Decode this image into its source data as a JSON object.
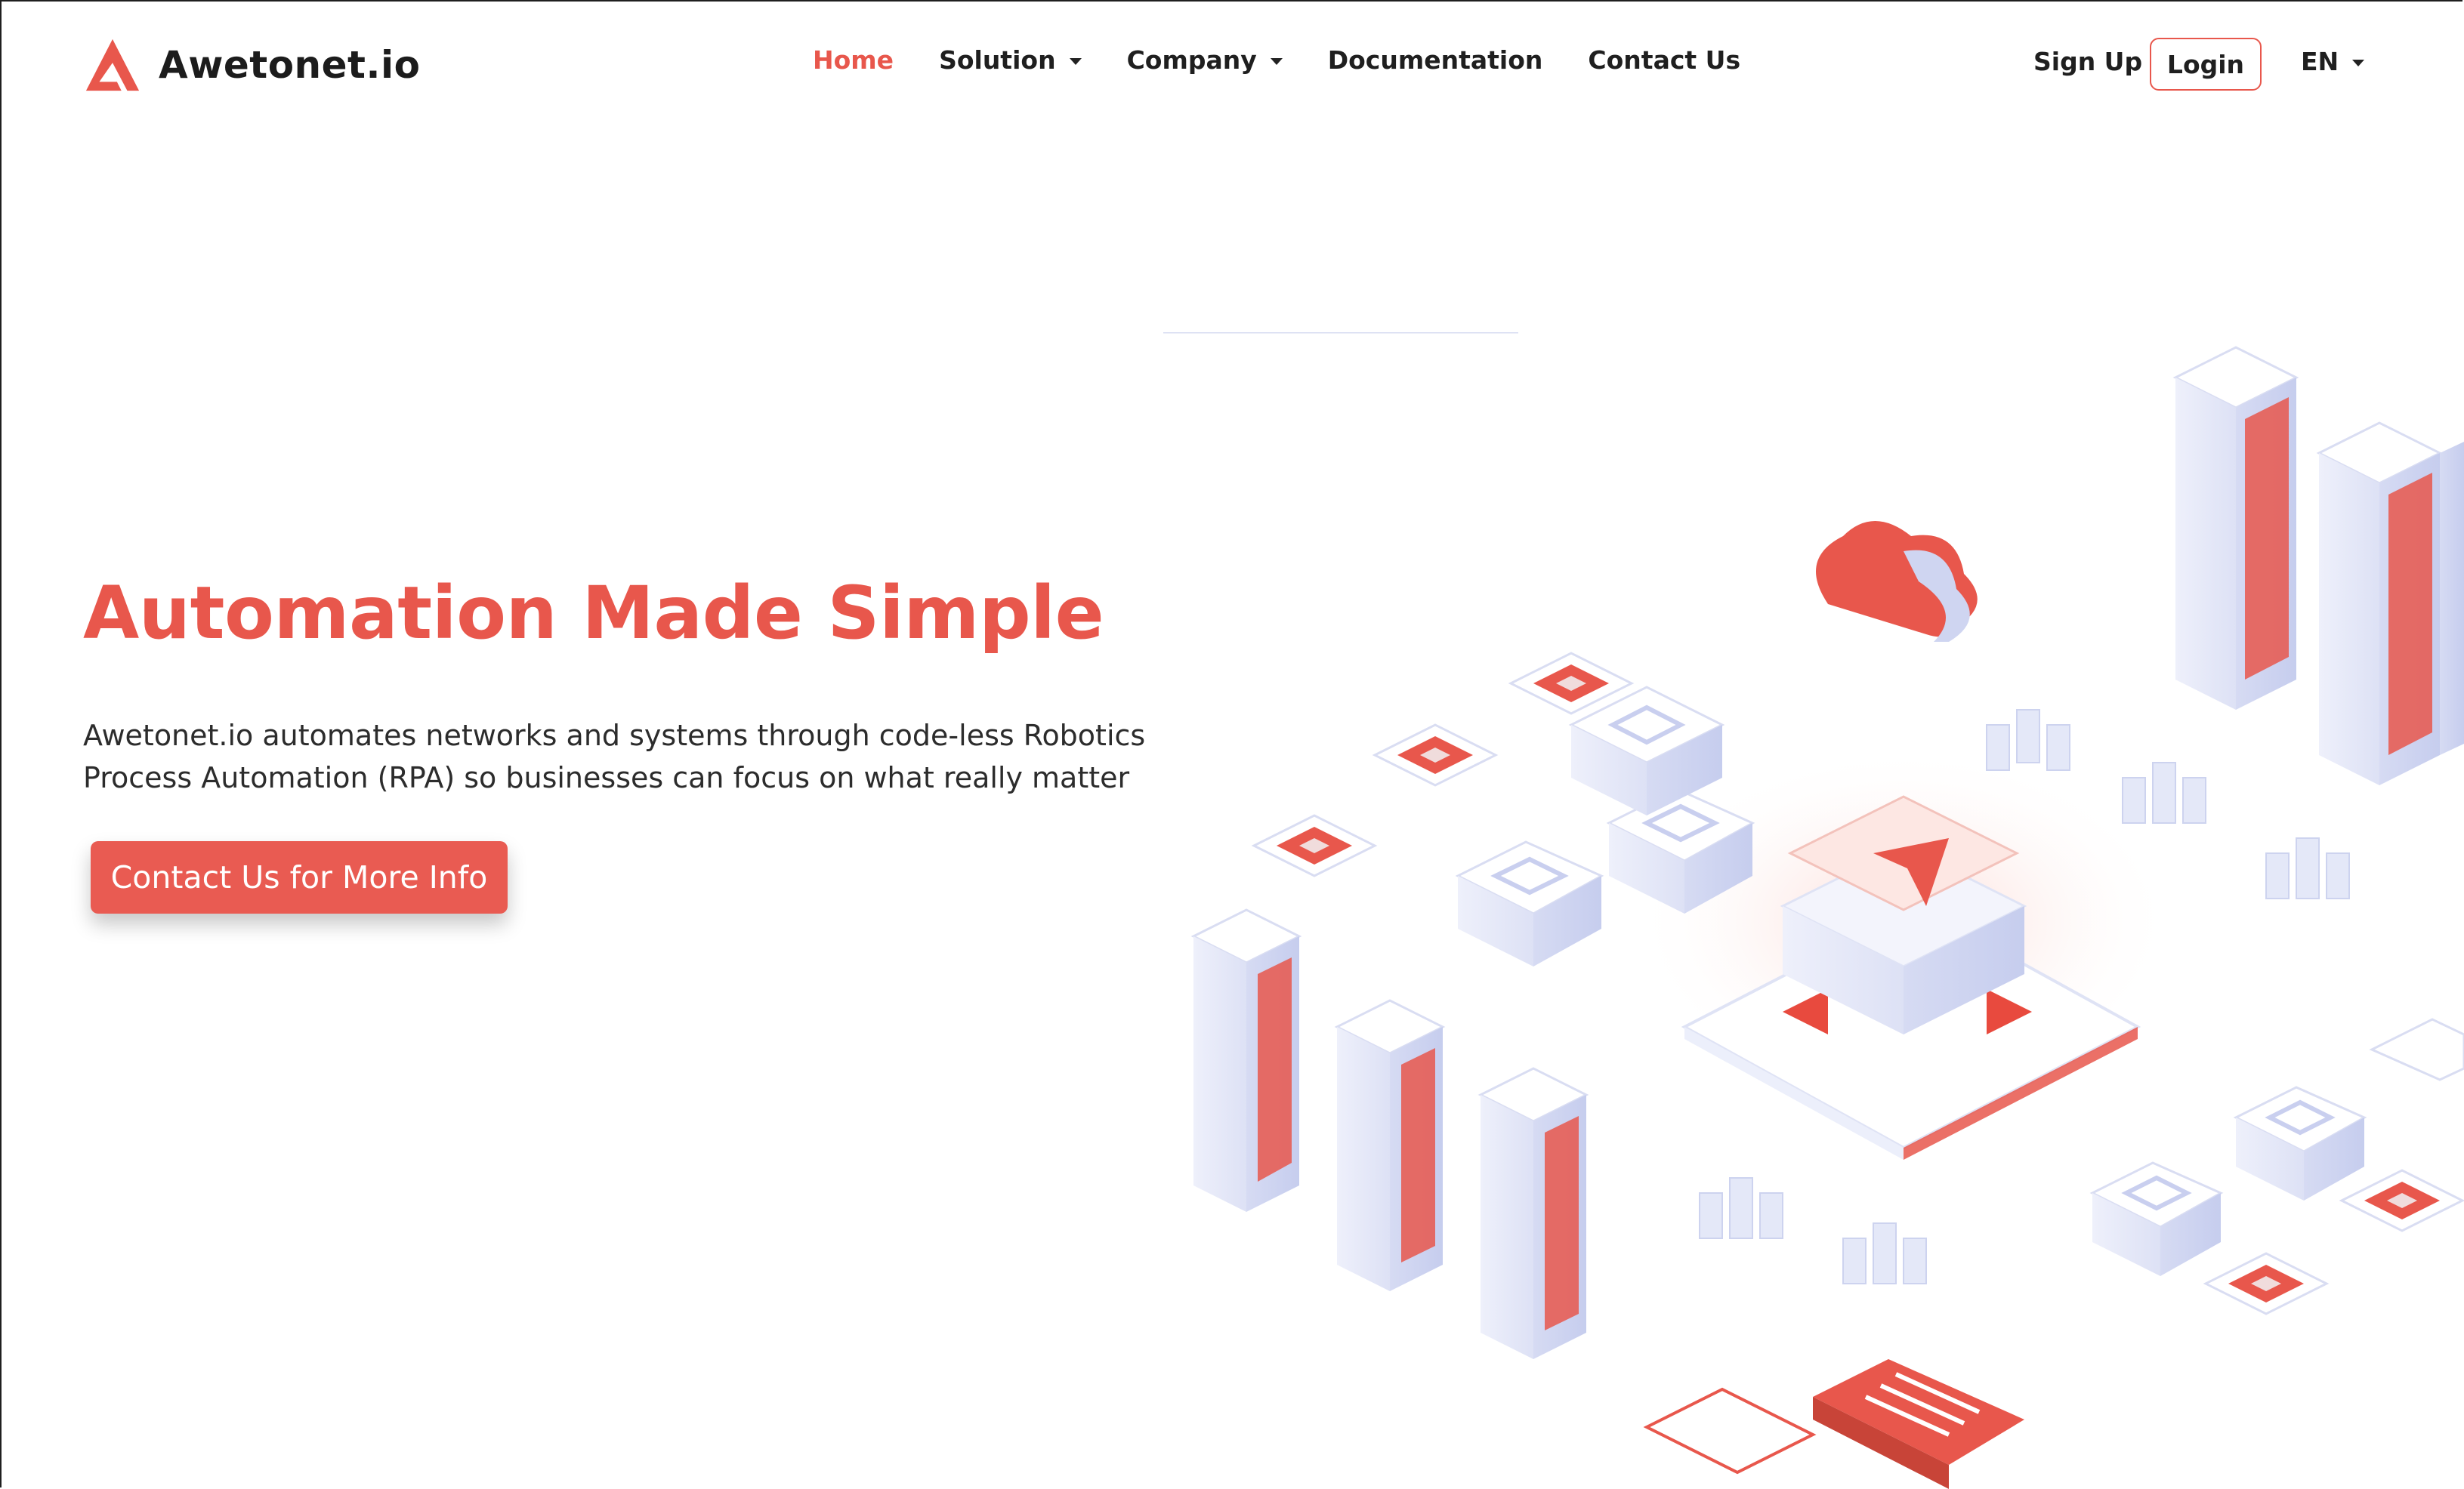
{
  "header": {
    "brand": "Awetonet.io",
    "logo_icon": "brand-a-icon",
    "nav": [
      {
        "label": "Home",
        "active": true,
        "dropdown": false
      },
      {
        "label": "Solution",
        "active": false,
        "dropdown": true
      },
      {
        "label": "Company",
        "active": false,
        "dropdown": true
      },
      {
        "label": "Documentation",
        "active": false,
        "dropdown": false
      },
      {
        "label": "Contact Us",
        "active": false,
        "dropdown": false
      }
    ],
    "signup_label": "Sign Up",
    "login_label": "Login",
    "language": "EN"
  },
  "hero": {
    "title": "Automation Made Simple",
    "description": "Awetonet.io automates networks and systems through code-less Robotics Process Automation (RPA) so businesses can focus on what really matter",
    "cta_label": "Contact Us for More Info",
    "illustration": "isometric-automation-city-illustration"
  },
  "colors": {
    "accent": "#e8574c",
    "text": "#1f1f1f",
    "background": "#ffffff"
  }
}
